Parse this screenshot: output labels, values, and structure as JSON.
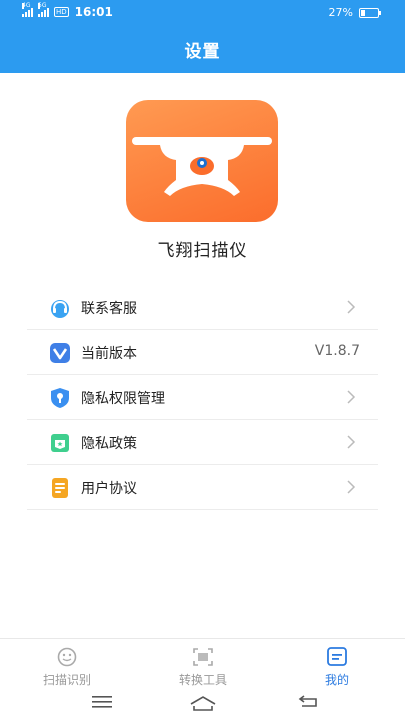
{
  "status_bar": {
    "sim1": "4G",
    "sim2": "5G",
    "hd": "HD",
    "time": "16:01",
    "battery": "27%",
    "battery_level": 0.27
  },
  "header": {
    "title": "设置"
  },
  "app": {
    "name": "飞翔扫描仪",
    "logo_icon": "drone-logo-icon"
  },
  "menu": [
    {
      "label": "联系客服",
      "icon": "headset-icon",
      "right": "chevron"
    },
    {
      "label": "当前版本",
      "icon": "version-icon",
      "right": "V1.8.7"
    },
    {
      "label": "隐私权限管理",
      "icon": "shield-lock-icon",
      "right": "chevron"
    },
    {
      "label": "隐私政策",
      "icon": "policy-badge-icon",
      "right": "chevron"
    },
    {
      "label": "用户协议",
      "icon": "document-icon",
      "right": "chevron"
    }
  ],
  "tabs": [
    {
      "label": "扫描识别",
      "icon": "scan-smile-icon",
      "active": false
    },
    {
      "label": "转换工具",
      "icon": "convert-frame-icon",
      "active": false
    },
    {
      "label": "我的",
      "icon": "profile-card-icon",
      "active": true
    }
  ],
  "colors": {
    "header_blue": "#2c9bf0",
    "logo_orange": "#fb6d2c",
    "tab_active": "#2c7be0"
  }
}
